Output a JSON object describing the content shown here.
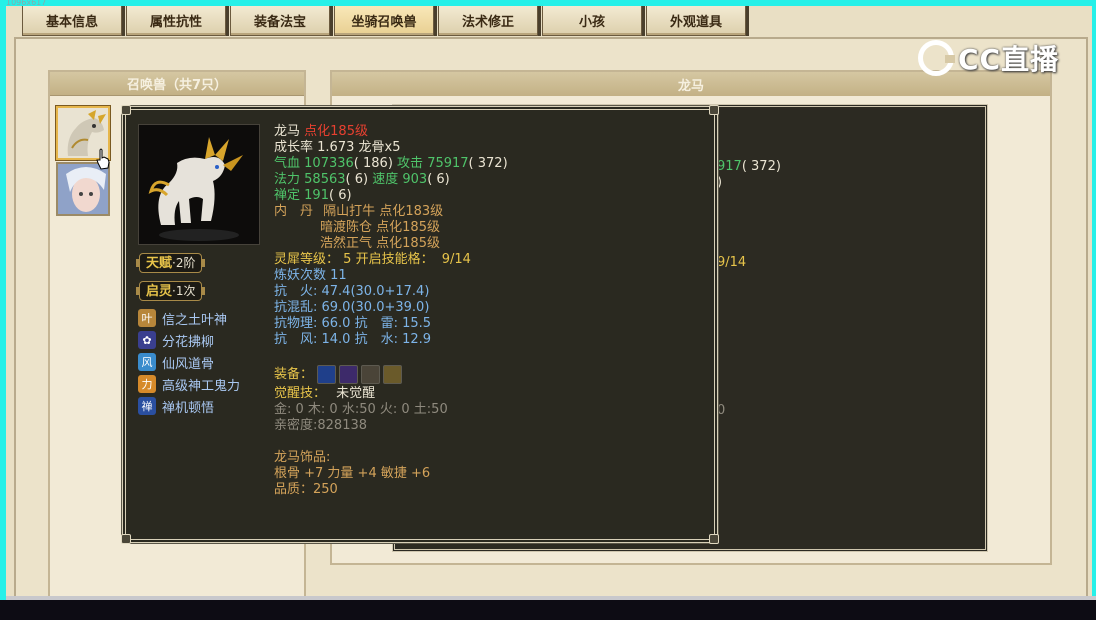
{
  "window": {
    "corner_text": "1096x617"
  },
  "tabs": [
    {
      "label": "基本信息"
    },
    {
      "label": "属性抗性"
    },
    {
      "label": "装备法宝"
    },
    {
      "label": "坐骑召唤兽",
      "active": true
    },
    {
      "label": "法术修正"
    },
    {
      "label": "小孩"
    },
    {
      "label": "外观道具"
    }
  ],
  "left_panel": {
    "title": "召唤兽（共7只）"
  },
  "right_panel": {
    "title": "龙马"
  },
  "background_card": {
    "attack_fragment": "917",
    "attack_paren": "( 372)",
    "paren_fragment": ")",
    "skill_fragment": "9/14",
    "digit_fragment": "0"
  },
  "tooltip": {
    "name": "龙马",
    "level": "点化185级",
    "growth_label": "成长率",
    "growth_value": "1.673",
    "bone": "龙骨x5",
    "hp_label": "气血",
    "hp_value": "107336",
    "hp_paren": "( 186)",
    "atk_label": "攻击",
    "atk_value": "75917",
    "atk_paren": "( 372)",
    "mp_label": "法力",
    "mp_value": "58563",
    "mp_paren": "( 6)",
    "spd_label": "速度",
    "spd_value": "903",
    "spd_paren": "( 6)",
    "zen_label": "禅定",
    "zen_value": "191",
    "zen_paren": "( 6)",
    "neidan_label": "内　丹",
    "neidan": [
      {
        "name": "隔山打牛",
        "level": "点化183级"
      },
      {
        "name": "暗渡陈仓",
        "level": "点化185级"
      },
      {
        "name": "浩然正气",
        "level": "点化185级"
      }
    ],
    "lingxi_label": "灵犀等级：",
    "lingxi_value": "5",
    "open_skill_label": "开启技能格：",
    "open_skill_value": "9/14",
    "refine_label": "炼妖次数",
    "refine_value": "11",
    "res_fire": "抗　火: 47.4(30.0+17.4)",
    "res_chaos": "抗混乱: 69.0(30.0+39.0)",
    "res_phys": "抗物理: 66.0 抗　雷: 15.5",
    "res_wind": "抗　风: 14.0 抗　水: 12.9",
    "equip_label": "装备：",
    "awaken_label": "觉醒技：",
    "awaken_value": "未觉醒",
    "elements": "金: 0 木: 0 水:50 火: 0 土:50",
    "intimacy": "亲密度:828138",
    "ornament_label": "龙马饰品:",
    "ornament_stats": "根骨 +7 力量 +4 敏捷 +6",
    "quality": "品质：250",
    "talent_tag": "天赋",
    "talent_sub": "·2阶",
    "qiling_tag": "启灵",
    "qiling_sub": "·1次",
    "skills": [
      {
        "name": "信之土叶神",
        "icon": "leaf-spirit-icon",
        "color": "#b7863a"
      },
      {
        "name": "分花拂柳",
        "icon": "petal-icon",
        "color": "#3a3f8f"
      },
      {
        "name": "仙风道骨",
        "icon": "wind-bone-icon",
        "color": "#3a8ccc"
      },
      {
        "name": "高级神工鬼力",
        "icon": "divine-force-icon",
        "color": "#d68a2a"
      },
      {
        "name": "禅机顿悟",
        "icon": "zen-icon",
        "color": "#2a4fa0"
      }
    ]
  },
  "watermark": {
    "text": "CC直播"
  }
}
